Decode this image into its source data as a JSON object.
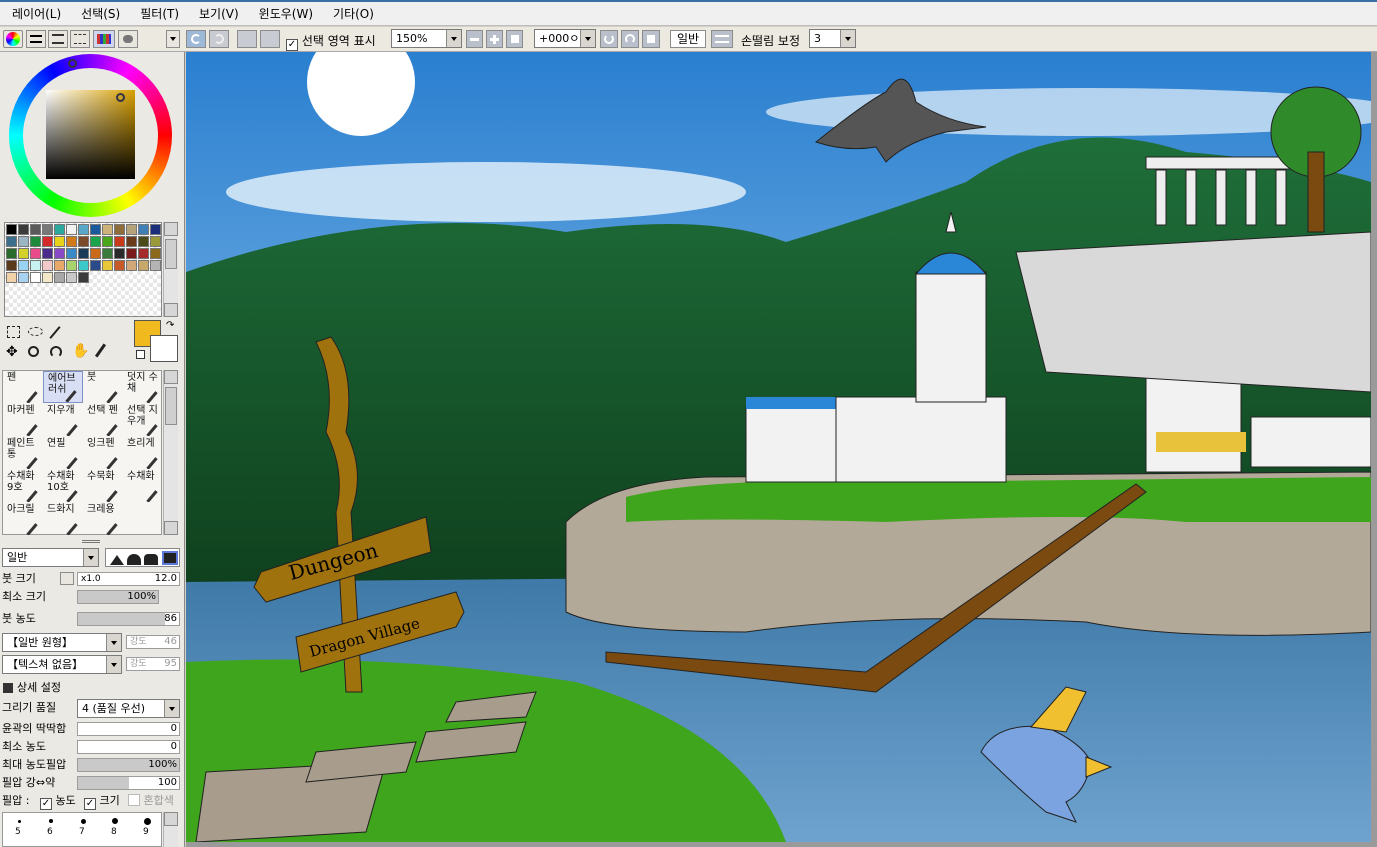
{
  "menu": [
    "레이어(L)",
    "선택(S)",
    "필터(T)",
    "보기(V)",
    "윈도우(W)",
    "기타(O)"
  ],
  "toolbar": {
    "selection_checkbox": "선택 영역 표시",
    "zoom": "150%",
    "rotation": "+000ㅇ",
    "blend": "일반",
    "stabilizer_label": "손떨림 보정",
    "stabilizer_value": "3"
  },
  "colors": {
    "accent": "#f0b91e",
    "swatches": [
      "#000000",
      "#3c3c3c",
      "#5a5a5a",
      "#787878",
      "#2aa99c",
      "#f2f2f2",
      "#58a6c8",
      "#1a5a9a",
      "#cdb37a",
      "#8f6d3a",
      "#b7a37a",
      "#3f7fb5",
      "#1a2e7a",
      "#3b6f8c",
      "#9bb6c2",
      "#1c8a3a",
      "#d42a2a",
      "#e8d21a",
      "#d27a1a",
      "#7a4a2a",
      "#1aa54a",
      "#4aa51a",
      "#c83a1a",
      "#6a3a1a",
      "#4a4a1a",
      "#9a9a3a",
      "#2a6a2a",
      "#d2d22a",
      "#e84a8a",
      "#4a2a8a",
      "#8a4ac8",
      "#3a8ac8",
      "#1a3a5a",
      "#c86a1a",
      "#3a7a3a",
      "#2a2a2a",
      "#7a1a1a",
      "#a52a2a",
      "#8a6a1a",
      "#5a3a1a",
      "#9ad2f2",
      "#c8f2f2",
      "#f2c8c8",
      "#e8a86a",
      "#a8d26a",
      "#3ac8c8",
      "#2a4a8a",
      "#e8c83a",
      "#c85a2a",
      "#d2a87a",
      "#c8a86a",
      "#b4b4b4",
      "#f2d2a8",
      "#a8d2f2",
      "#ffffff",
      "#f2e8c8",
      "#a8a8a8",
      "#c8c8c8",
      "#3a3a3a"
    ]
  },
  "tools": [
    [
      "펜",
      "에어브러쉬",
      "붓",
      "덧지 수채"
    ],
    [
      "마커펜",
      "지우개",
      "선택 펜",
      "선택 지우개"
    ],
    [
      "페인트 통",
      "연필",
      "잉크펜",
      "흐리게"
    ],
    [
      "수채화 9호",
      "수채화 10호",
      "수묵화",
      "수채화"
    ],
    [
      "아크릴",
      "드화지",
      "크레용",
      ""
    ]
  ],
  "brush": {
    "mode": "일반",
    "size_label": "붓 크기",
    "size_mult": "x1.0",
    "size_value": "12.0",
    "minsize_label": "최소 크기",
    "minsize_value": "100%",
    "density_label": "붓 농도",
    "density_value": "86",
    "shape": "【일반 원형】",
    "shape_strength_label": "강도",
    "shape_strength": "46",
    "texture": "【텍스쳐 없음】",
    "texture_strength_label": "강도",
    "texture_strength": "95",
    "advanced": "상세 설정",
    "quality_label": "그리기 품질",
    "quality_value": "4 (품질 우선)",
    "edge_label": "윤곽의 딱딱함",
    "edge_value": "0",
    "mindensity_label": "최소 농도",
    "mindensity_value": "0",
    "maxpress_label": "최대 농도필압",
    "maxpress_value": "100%",
    "pressure_label": "필압 강⇔약",
    "pressure_value": "100",
    "pressure_title": "필압 :",
    "opt_density": "농도",
    "opt_size": "크기",
    "opt_blend": "혼합색",
    "size_presets_row1": [
      "5",
      "6",
      "7",
      "8",
      "9"
    ]
  },
  "canvas": {
    "sign_top": "Dungeon",
    "sign_bottom": "Dragon Village"
  }
}
